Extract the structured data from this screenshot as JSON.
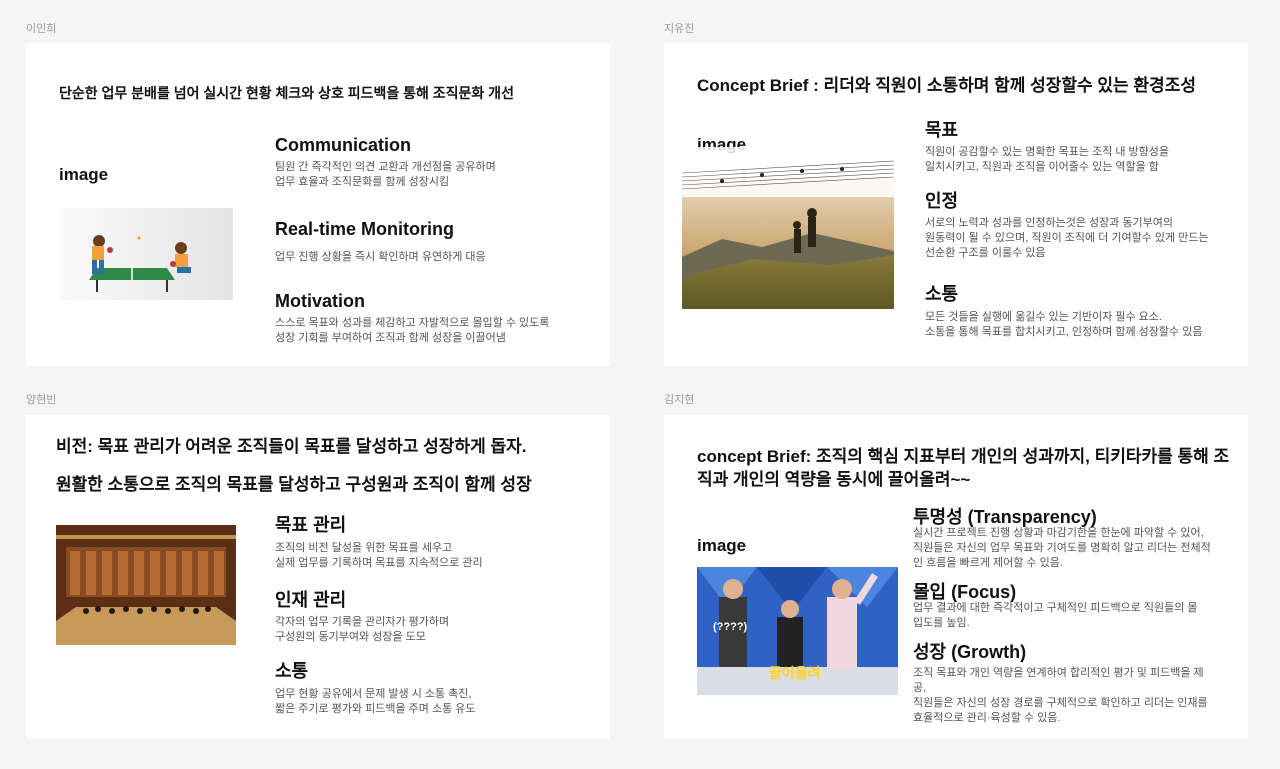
{
  "cards": [
    {
      "author": "이민희",
      "headline": "단순한 업무 분배를 넘어 실시간 현황 체크와 상호 피드백을 통해 조직문화 개선",
      "image_label": "image",
      "image_alt": "table-tennis-illustration",
      "sections": [
        {
          "title": "Communication",
          "body": "팀원 간 즉각적인 의견 교환과 개선점을 공유하며\n업무 효율과 조직문화를 함께 성장시킴"
        },
        {
          "title": "Real-time Monitoring",
          "body": "업무 진행 상황을 즉시 확인하며 유연하게 대응"
        },
        {
          "title": "Motivation",
          "body": "스스로 목표와 성과를 체감하고 자발적으로 몰입할 수 있도록\n성장 기회를 부여하여 조직과 함께 성장을 이끌어냄"
        }
      ]
    },
    {
      "author": "지유진",
      "headline": "Concept Brief : 리더와 직원이 소통하며 함께 성장할수 있는 환경조성",
      "image_label": "image",
      "image_alt": "hikers-sunset-photo",
      "sections": [
        {
          "title": "목표",
          "body": "직원이 공감할수 있는 명확한 목표는 조직 내 방향성을\n일치시키고, 직원과 조직을 이어줄수 있는 역할을 함"
        },
        {
          "title": "인정",
          "body": "서로의 노력과 성과를 인정하는것은 성장과 동기부여의\n원동력이 될 수 있으며, 직원이 조직에 더 기여할수 있게 만드는\n선순환 구조를 이룰수 있음"
        },
        {
          "title": "소통",
          "body": "모든 것들을 실행에 옮길수 있는 기반이자 필수 요소.\n소통을 통해 목표를 합치시키고, 인정하며 함께 성장할수 있음"
        }
      ]
    },
    {
      "author": "양현빈",
      "headline": "비전: 목표 관리가 어려운 조직들이 목표를 달성하고 성장하게 돕자.",
      "headline2": "원활한 소통으로 조직의 목표를 달성하고 구성원과 조직이 함께 성장",
      "image_alt": "orchestra-concert-photo",
      "sections": [
        {
          "title": "목표 관리",
          "body": "조직의 비전 달성을 위한 목표를 세우고\n실제 업무를 기록하며 목표를 지속적으로 관리"
        },
        {
          "title": "인재 관리",
          "body": "각자의 업무 기록을 관리자가 평가하며\n구성원의 동기부여와 성장을 도모"
        },
        {
          "title": "소통",
          "body": "업무 현황 공유에서 문제 발생 시 소통 촉진,\n짧은 주기로 평가와 피드백을 주며 소통 유도"
        }
      ]
    },
    {
      "author": "김지현",
      "headline": "concept Brief: 조직의 핵심 지표부터 개인의 성과까지, 티키타카를 통해 조직과 개인의 역량을 동시에 끌어올려~~",
      "image_label": "image",
      "image_alt": "tv-show-screenshot",
      "caption_a": "(????)",
      "caption_b": "끌어올려",
      "sections": [
        {
          "title": "투명성 (Transparency)",
          "body": "실시간 프로젝트 진행 상황과 마감기한을 한눈에 파악할 수 있어,\n직원들은 자신의 업무 목표와 기여도를 명확히 알고 리더는 전체적\n인 흐름을 빠르게 제어할 수 있음."
        },
        {
          "title": "몰입 (Focus)",
          "body": "업무 결과에 대한 즉각적이고 구체적인 피드백으로 직원들의 몰\n입도를 높임."
        },
        {
          "title": "성장 (Growth)",
          "body": "조직 목표와 개인 역량을 연계하여 합리적인 평가 및 피드백을 제\n공,\n직원들은 자신의 성장 경로를 구체적으로 확인하고 리더는 인재를\n효율적으로 관리·육성할 수 있음."
        }
      ]
    }
  ]
}
